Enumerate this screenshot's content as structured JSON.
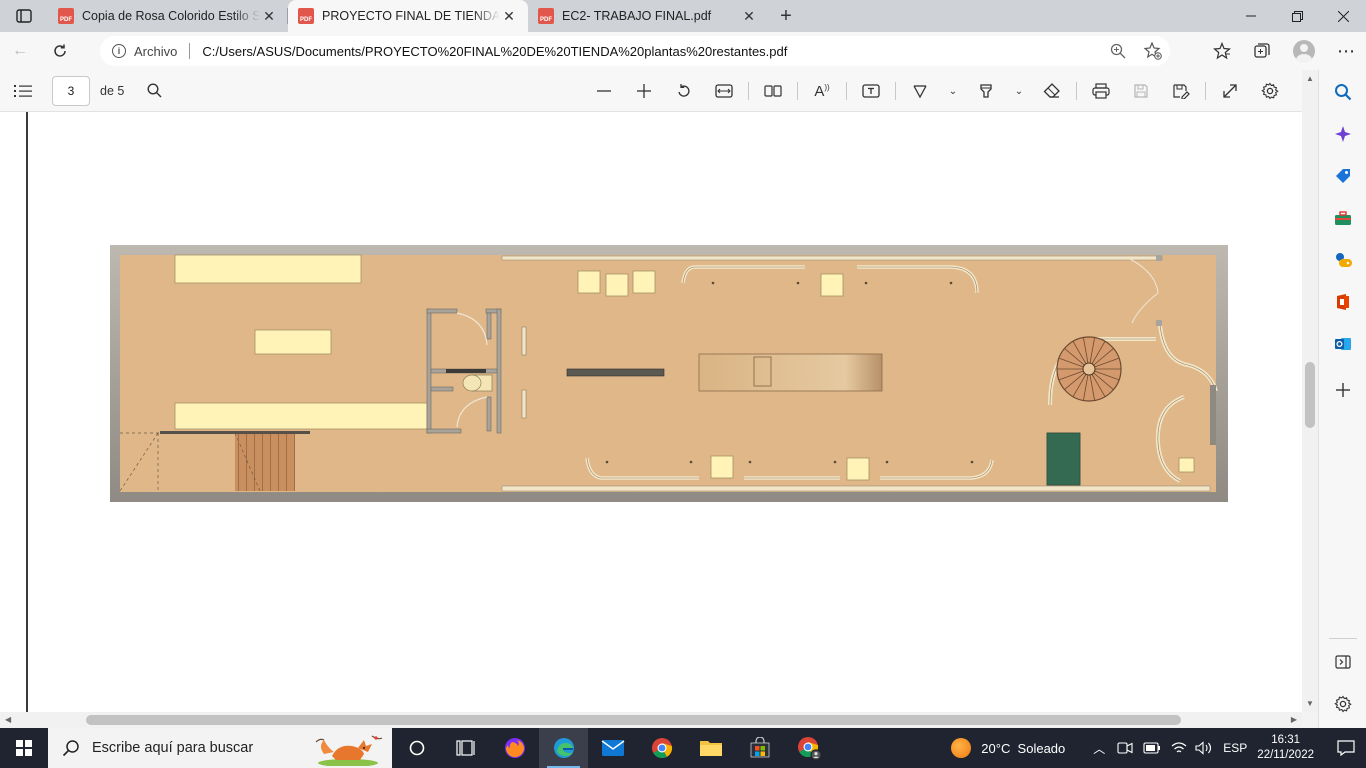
{
  "browser": {
    "tabs": [
      {
        "title": "Copia de Rosa Colorido Estilo Se",
        "active": false
      },
      {
        "title": "PROYECTO FINAL DE TIENDA pla",
        "active": true
      },
      {
        "title": "EC2- TRABAJO FINAL.pdf",
        "active": false
      }
    ],
    "new_tab_glyph": "+",
    "address": {
      "label": "Archivo",
      "url": "C:/Users/ASUS/Documents/PROYECTO%20FINAL%20DE%20TIENDA%20plantas%20restantes.pdf"
    }
  },
  "pdf_toolbar": {
    "current_page": "3",
    "page_total_label": "de 5"
  },
  "taskbar": {
    "search_placeholder": "Escribe aquí para buscar",
    "weather": "20°C  Soleado",
    "language": "ESP",
    "time": "16:31",
    "date": "22/11/2022"
  },
  "colors": {
    "floor": "#dcb07e",
    "wall": "#a39e96",
    "furniture": "#fff3b8",
    "planter": "#2e5e4a",
    "edge_accent": "#0f6cbd"
  }
}
